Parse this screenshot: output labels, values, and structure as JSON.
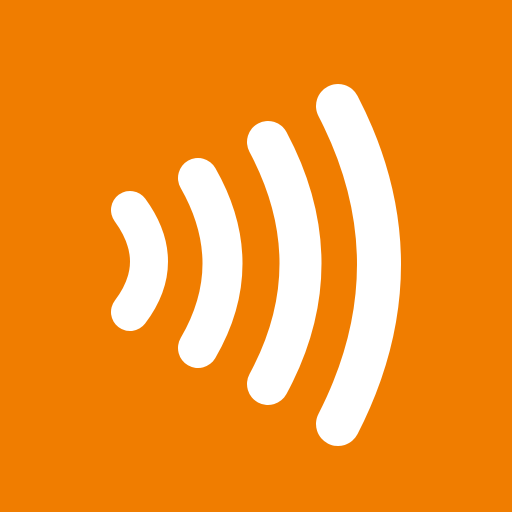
{
  "icon": {
    "name": "contactless-icon",
    "colors": {
      "background": "#F07D00",
      "foreground": "#FFFFFF"
    },
    "wave_count": 4
  }
}
